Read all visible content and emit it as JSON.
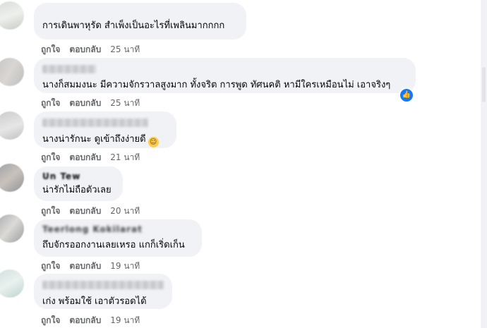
{
  "comments": [
    {
      "name": "",
      "text": "การเดินพาหุรัด สำเพ็งเป็นอะไรที่เพลินมากกกก",
      "like_label": "ถูกใจ",
      "reply_label": "ตอบกลับ",
      "time": "25 นาที"
    },
    {
      "name": "",
      "text": "นางก็สมมงนะ มีความจักรวาลสูงมาก ทั้งจริต การพูด ทัศนคติ หามีใครเหมือนไม่ เอาจริงๆ",
      "like_label": "ถูกใจ",
      "reply_label": "ตอบกลับ",
      "time": "25 นาที",
      "reaction_icon": "like-icon"
    },
    {
      "name": "",
      "text": "นางน่ารักนะ ดูเข้าถึงง่ายดี",
      "emoji": "☺",
      "like_label": "ถูกใจ",
      "reply_label": "ตอบกลับ",
      "time": "21 นาที"
    },
    {
      "name": "Un Tew",
      "text": "น่ารักไม่ถือตัวเลย",
      "like_label": "ถูกใจ",
      "reply_label": "ตอบกลับ",
      "time": "20 นาที"
    },
    {
      "name": "Teerlong Kokilarat",
      "text": "ถึบจักรออกงานเลยเหรอ แกก็เริ่ดเก็น",
      "like_label": "ถูกใจ",
      "reply_label": "ตอบกลับ",
      "time": "19 นาที"
    },
    {
      "name": "",
      "text": "เก่ง พร้อมใช้ เอาตัวรอดได้",
      "like_label": "ถูกใจ",
      "reply_label": "ตอบกลับ",
      "time": "19 นาที"
    }
  ],
  "colors": {
    "bubble": "#f0f2f5",
    "meta": "#65676b",
    "text": "#050505",
    "like_badge": "#1877f2"
  }
}
